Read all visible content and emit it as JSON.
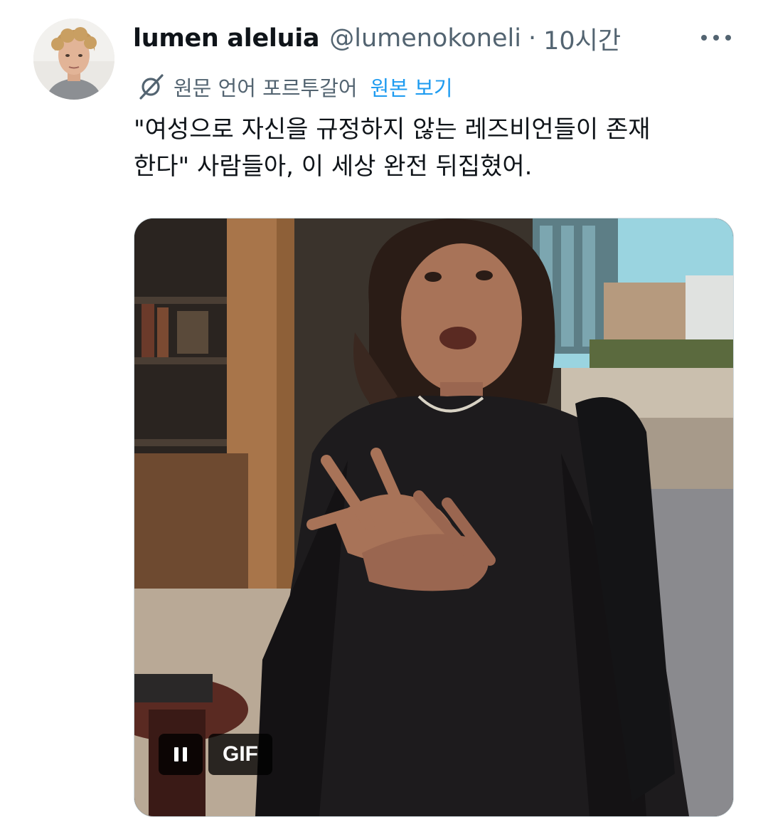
{
  "tweet": {
    "author": {
      "display_name": "lumen aleluia",
      "handle": "@lumenokoneli",
      "avatar": "profile-photo"
    },
    "separator": "·",
    "timestamp": "10시간",
    "more_icon": "more-horizontal-icon",
    "translation": {
      "icon": "translate-icon",
      "source_language": "원문 언어 포르투갈어",
      "view_original_label": "원본 보기"
    },
    "text": "\"여성으로 자신을 규정하지 않는 레즈비언들이 존재\n한다\" 사람들아, 이 세상 완전 뒤집혔어.",
    "media": {
      "type": "gif",
      "pause_icon": "pause-icon",
      "badge_label": "GIF"
    }
  },
  "colors": {
    "text_primary": "#0f1419",
    "text_secondary": "#536471",
    "link": "#1d9bf0",
    "background": "#ffffff"
  }
}
